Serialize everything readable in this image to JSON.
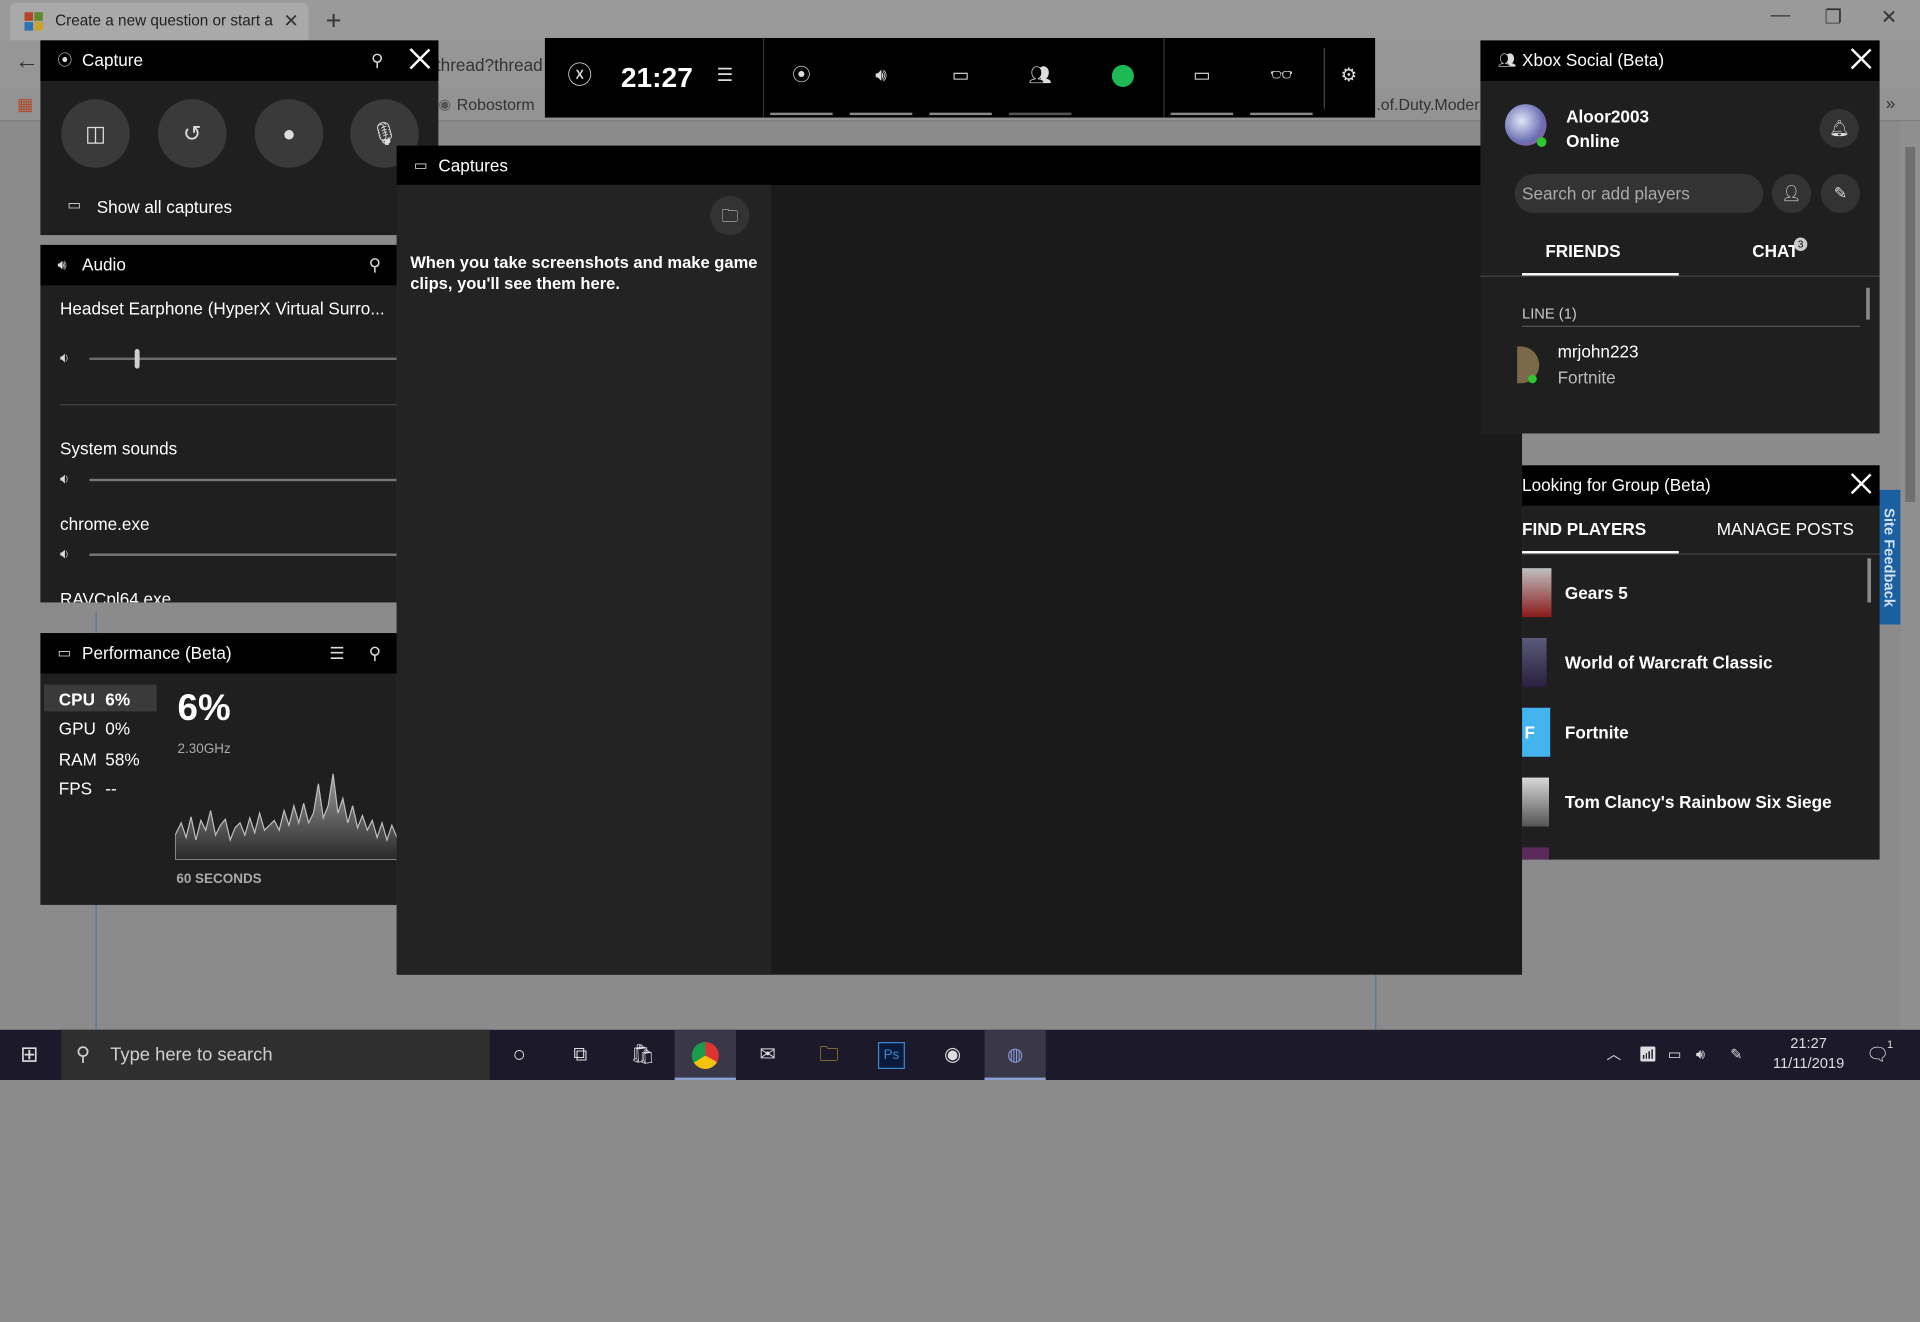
{
  "browser": {
    "tab_title": "Create a new question or start a",
    "url_fragment": "thread?thread",
    "bookmark": "Robostorm",
    "partial_text": ".of.Duty.Modern",
    "site_feedback": "Site Feedback"
  },
  "topbar": {
    "time": "21:27"
  },
  "capture": {
    "title": "Capture",
    "show_all": "Show all captures"
  },
  "audio": {
    "title": "Audio",
    "device": "Headset Earphone (HyperX Virtual Surro...",
    "device_level": 0.15,
    "apps": [
      {
        "name": "System sounds",
        "level": 1.0
      },
      {
        "name": "chrome.exe",
        "level": 1.0
      },
      {
        "name": "RAVCpl64.exe",
        "level": 1.0
      }
    ]
  },
  "performance": {
    "title": "Performance (Beta)",
    "stats": [
      {
        "label": "CPU",
        "value": "6%"
      },
      {
        "label": "GPU",
        "value": "0%"
      },
      {
        "label": "RAM",
        "value": "58%"
      },
      {
        "label": "FPS",
        "value": "--"
      }
    ],
    "big_value": "6%",
    "freq": "2.30GHz",
    "window": "60 SECONDS"
  },
  "captures": {
    "title": "Captures",
    "empty_message": "When you take screenshots and make game clips, you'll see them here."
  },
  "social": {
    "title": "Xbox Social (Beta)",
    "username": "Aloor2003",
    "status": "Online",
    "search_placeholder": "Search or add players",
    "tabs": [
      "FRIENDS",
      "CHAT"
    ],
    "chat_badge": "3",
    "section": "LINE  (1)",
    "friends": [
      {
        "name": "mrjohn223",
        "game": "Fortnite"
      }
    ]
  },
  "lfg": {
    "title": "Looking for Group (Beta)",
    "tabs": [
      "FIND PLAYERS",
      "MANAGE POSTS"
    ],
    "games": [
      "Gears 5",
      "World of Warcraft Classic",
      "Fortnite",
      "Tom Clancy's Rainbow Six Siege"
    ]
  },
  "taskbar": {
    "search_placeholder": "Type here to search",
    "time": "21:27",
    "date": "11/11/2019",
    "notifications": "1",
    "ps_label": "Ps"
  },
  "colors": {
    "accent_green": "#107c10",
    "spotify": "#1db954",
    "online": "#2fc52f"
  }
}
